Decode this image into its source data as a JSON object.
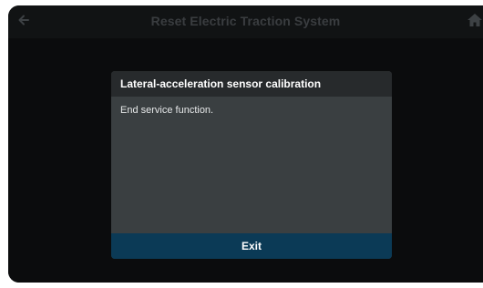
{
  "header": {
    "title": "Reset Electric Traction System",
    "back_icon": "arrow-left-icon",
    "home_icon": "home-icon"
  },
  "dialog": {
    "title": "Lateral-acceleration sensor calibration",
    "message": "End service function.",
    "exit_label": "Exit"
  },
  "colors": {
    "screen_bg": "#0d0f10",
    "dialog_bg": "#3a3f41",
    "dialog_header_bg": "#272a2c",
    "exit_bg": "#0b3a56"
  }
}
